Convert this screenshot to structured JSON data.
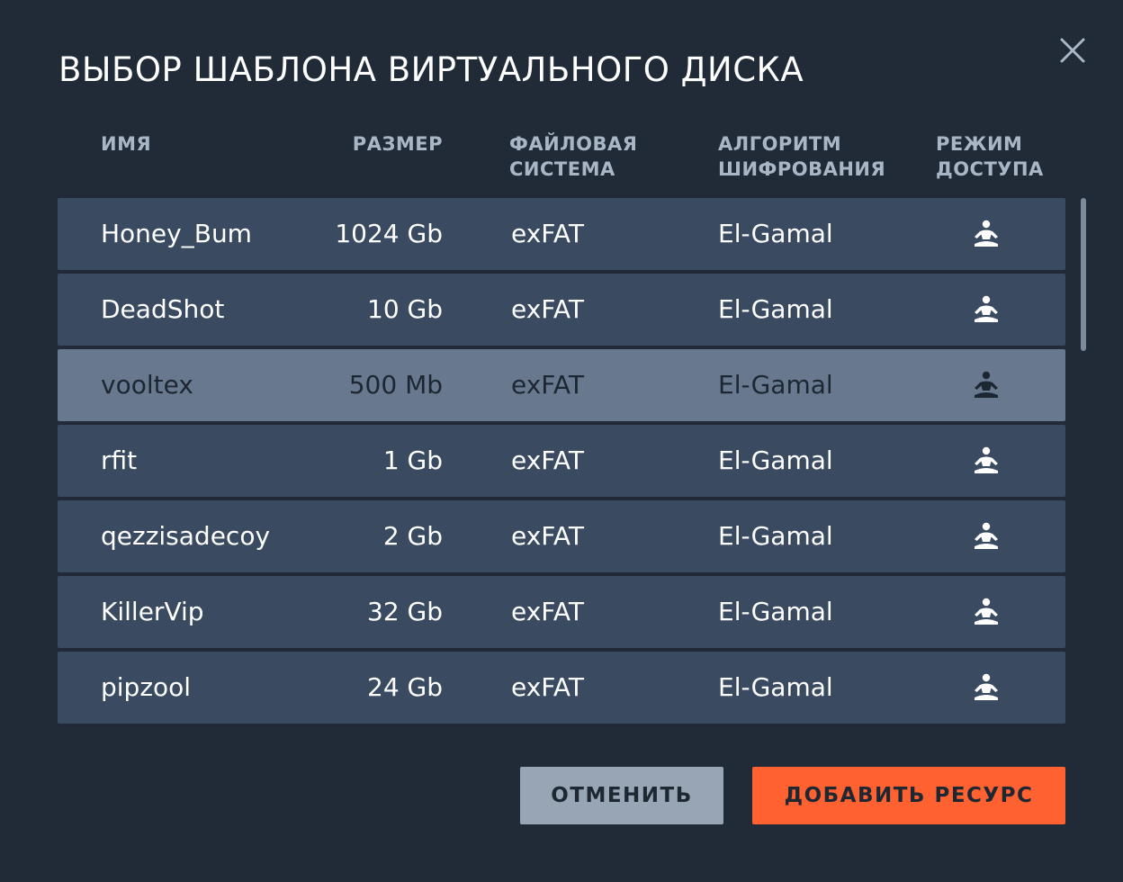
{
  "dialog": {
    "title": "ВЫБОР ШАБЛОНА ВИРТУАЛЬНОГО ДИСКА",
    "close_icon": "close-icon"
  },
  "table": {
    "columns": {
      "name": "ИМЯ",
      "size": "РАЗМЕР",
      "fs": "ФАЙЛОВАЯ\nСИСТЕМА",
      "alg": "АЛГОРИТМ\nШИФРОВАНИЯ",
      "mode": "РЕЖИМ\nДОСТУПА"
    },
    "rows": [
      {
        "name": "Honey_Bum",
        "size": "1024 Gb",
        "fs": "exFAT",
        "alg": "El-Gamal",
        "mode_icon": "meditation-icon"
      },
      {
        "name": "DeadShot",
        "size": "10 Gb",
        "fs": "exFAT",
        "alg": "El-Gamal",
        "mode_icon": "meditation-icon"
      },
      {
        "name": "vooltex",
        "size": "500 Mb",
        "fs": "exFAT",
        "alg": "El-Gamal",
        "mode_icon": "meditation-icon",
        "selected": true
      },
      {
        "name": "rfit",
        "size": "1 Gb",
        "fs": "exFAT",
        "alg": "El-Gamal",
        "mode_icon": "meditation-icon"
      },
      {
        "name": "qezzisadecoy",
        "size": "2 Gb",
        "fs": "exFAT",
        "alg": "El-Gamal",
        "mode_icon": "meditation-icon"
      },
      {
        "name": "KillerVip",
        "size": "32 Gb",
        "fs": "exFAT",
        "alg": "El-Gamal",
        "mode_icon": "meditation-icon"
      },
      {
        "name": "pipzool",
        "size": "24 Gb",
        "fs": "exFAT",
        "alg": "El-Gamal",
        "mode_icon": "meditation-icon"
      }
    ]
  },
  "buttons": {
    "cancel": "ОТМЕНИТЬ",
    "add": "ДОБАВИТЬ РЕСУРС"
  },
  "colors": {
    "background": "#212b38",
    "row": "#3a4a60",
    "row_selected": "#68788f",
    "accent": "#ff6130",
    "secondary_button": "#98a5b5",
    "header_text": "#a9b6c6"
  }
}
